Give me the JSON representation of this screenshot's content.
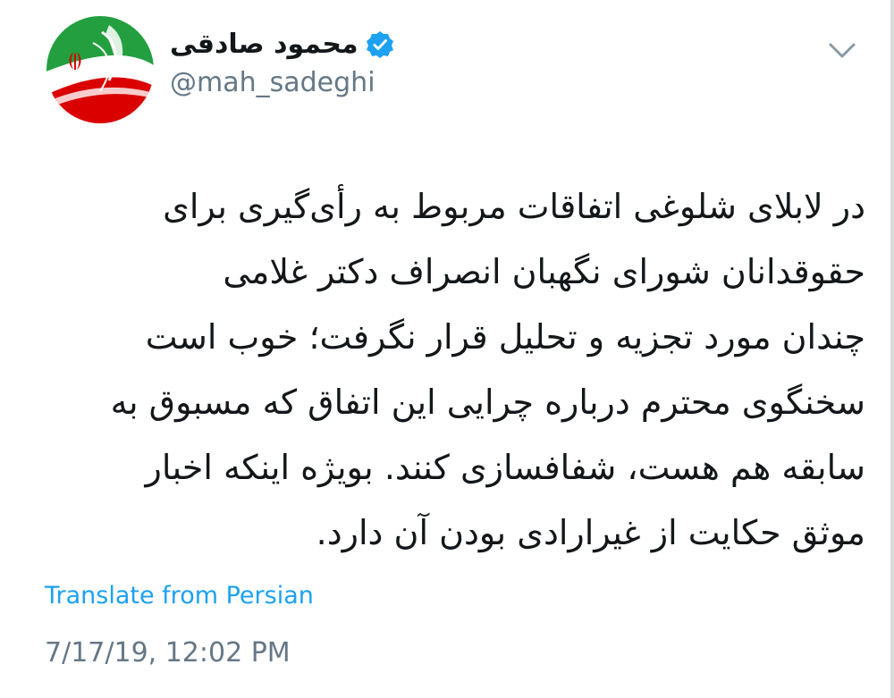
{
  "tweet": {
    "author": {
      "display_name": "محمود صادقی",
      "handle": "@mah_sadeghi",
      "verified": true,
      "avatar_icon": "iran-flag-emblem-avatar"
    },
    "text_lines": [
      "در لابلای شلوغی اتفاقات مربوط به رأی‌گیری  برای",
      "حقوقدانان شورای نگهبان انصراف دکتر غلامی",
      "چندان مورد تجزیه و تحلیل قرار نگرفت؛ خوب است",
      "سخنگوی محترم درباره چرایی این اتفاق که مسبوق به",
      "سابقه هم هست، شفافسازی کنند. بویژه اینکه اخبار",
      "موثق حکایت از غیرارادی بودن آن دارد."
    ],
    "translate_label": "Translate from Persian",
    "timestamp": "7/17/19, 12:02 PM"
  },
  "colors": {
    "link_blue": "#1da1f2",
    "secondary_gray": "#657786",
    "verified_blue": "#1da1f2",
    "flag_green": "#239f40",
    "flag_red": "#da0000"
  }
}
